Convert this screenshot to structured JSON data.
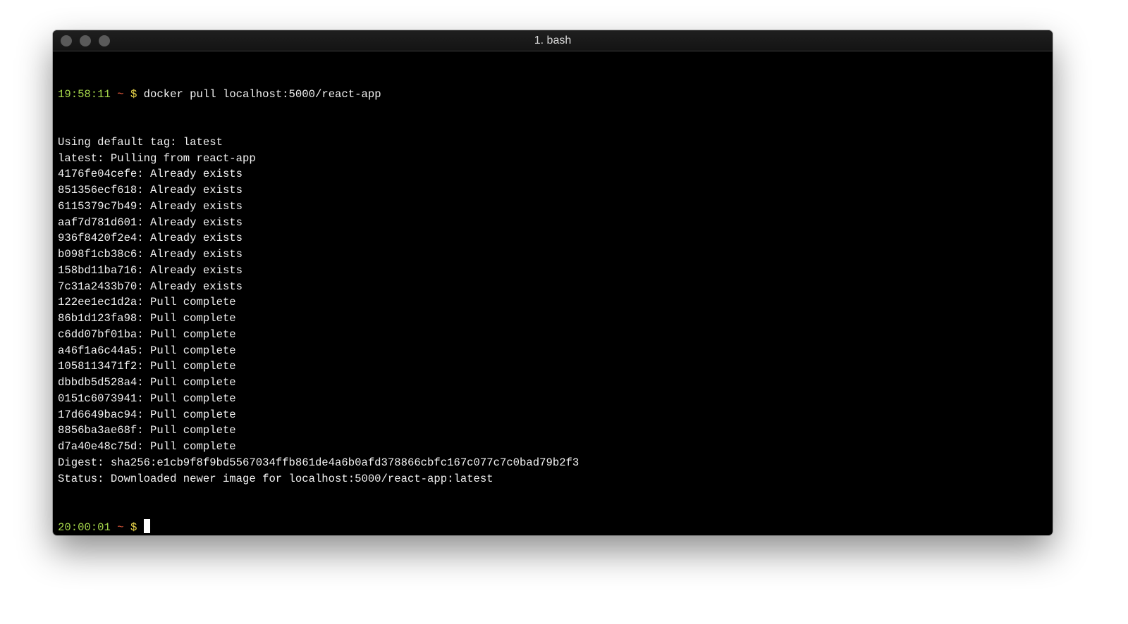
{
  "window": {
    "title": "1. bash"
  },
  "prompt1": {
    "time": "19:58:11",
    "tilde": "~",
    "dollar": "$",
    "command": "docker pull localhost:5000/react-app"
  },
  "output": [
    "Using default tag: latest",
    "latest: Pulling from react-app",
    "4176fe04cefe: Already exists",
    "851356ecf618: Already exists",
    "6115379c7b49: Already exists",
    "aaf7d781d601: Already exists",
    "936f8420f2e4: Already exists",
    "b098f1cb38c6: Already exists",
    "158bd11ba716: Already exists",
    "7c31a2433b70: Already exists",
    "122ee1ec1d2a: Pull complete",
    "86b1d123fa98: Pull complete",
    "c6dd07bf01ba: Pull complete",
    "a46f1a6c44a5: Pull complete",
    "1058113471f2: Pull complete",
    "dbbdb5d528a4: Pull complete",
    "0151c6073941: Pull complete",
    "17d6649bac94: Pull complete",
    "8856ba3ae68f: Pull complete",
    "d7a40e48c75d: Pull complete",
    "Digest: sha256:e1cb9f8f9bd5567034ffb861de4a6b0afd378866cbfc167c077c7c0bad79b2f3",
    "Status: Downloaded newer image for localhost:5000/react-app:latest"
  ],
  "prompt2": {
    "time": "20:00:01",
    "tilde": "~",
    "dollar": "$"
  }
}
